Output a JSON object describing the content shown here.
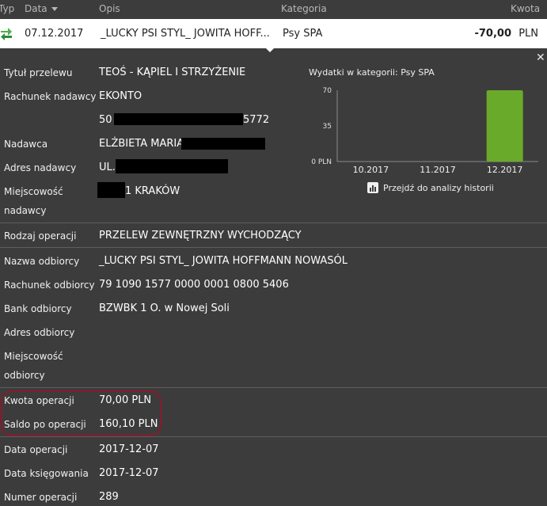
{
  "header": {
    "col_type": "Typ",
    "col_date": "Data",
    "col_desc": "Opis",
    "col_category": "Kategoria",
    "col_amount": "Kwota"
  },
  "transaction": {
    "date": "07.12.2017",
    "description": "_LUCKY PSI STYL_ JOWITA HOFF...",
    "category": "Psy SPA",
    "amount": "-70,00",
    "currency": "PLN"
  },
  "details": {
    "title_label": "Tytuł przelewu",
    "title_value": "TEOŚ - KĄPIEL I STRZYŻENIE",
    "sender_account_label": "Rachunek nadawcy",
    "sender_account_name": "EKONTO",
    "sender_account_prefix": "50",
    "sender_account_suffix": "5772",
    "sender_label": "Nadawca",
    "sender_value": "ELŻBIETA MARIA I",
    "sender_address_label": "Adres nadawcy",
    "sender_address_value": "UL.\\",
    "sender_city_label_1": "Miejscowość",
    "sender_city_label_2": "nadawcy",
    "sender_city_value": "1 KRAKÓW",
    "operation_type_label": "Rodzaj operacji",
    "operation_type_value": "PRZELEW ZEWNĘTRZNY WYCHODZĄCY",
    "recipient_name_label": "Nazwa odbiorcy",
    "recipient_name_value": "_LUCKY PSI STYL_ JOWITA HOFFMANN NOWASÓL",
    "recipient_account_label": "Rachunek odbiorcy",
    "recipient_account_value": "79 1090 1577 0000 0001 0800 5406",
    "recipient_bank_label": "Bank odbiorcy",
    "recipient_bank_value": "BZWBK 1 O. w Nowej Soli",
    "recipient_address_label": "Adres odbiorcy",
    "recipient_city_label_1": "Miejscowość",
    "recipient_city_label_2": "odbiorcy",
    "operation_amount_label": "Kwota operacji",
    "operation_amount_value": "70,00 PLN",
    "balance_label": "Saldo po operacji",
    "balance_value": "160,10 PLN",
    "operation_date_label": "Data operacji",
    "operation_date_value": "2017-12-07",
    "booking_date_label": "Data księgowania",
    "booking_date_value": "2017-12-07",
    "operation_number_label": "Numer operacji",
    "operation_number_value": "289"
  },
  "chart_panel": {
    "title": "Wydatki w kategorii:  Psy SPA",
    "history_link": "Przejdź do analizy historii"
  },
  "chart_data": {
    "type": "bar",
    "categories": [
      "10.2017",
      "11.2017",
      "12.2017"
    ],
    "values": [
      0,
      0,
      70
    ],
    "ylim": [
      0,
      70
    ],
    "y_ticks": [
      "70",
      "35",
      "0 PLN"
    ],
    "bar_color": "#6aaa2a"
  },
  "colors": {
    "background": "#3c3c3c",
    "highlight": "#8a1a2a",
    "transfer_icon": "#4caf50"
  }
}
